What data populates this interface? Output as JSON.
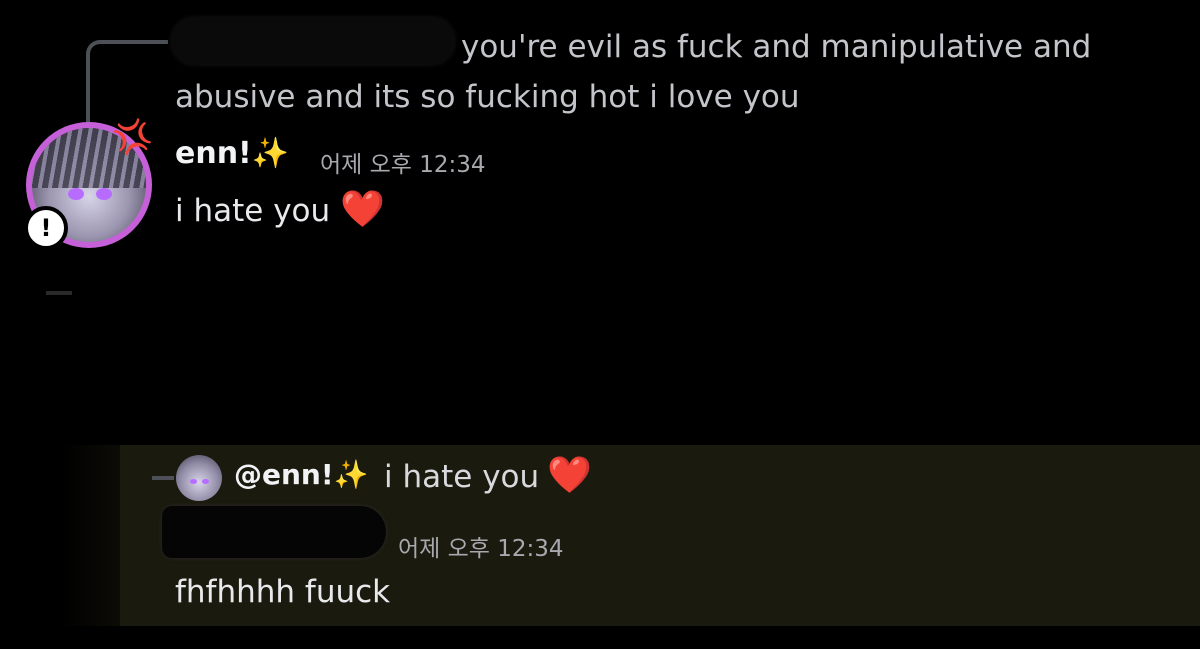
{
  "colors": {
    "background": "#000000",
    "mention_highlight": "#1b1a0e",
    "avatar_ring": "#c560d8",
    "heart": "#e8192e",
    "text_primary": "#f2f3f5",
    "text_muted": "#a7a9ae"
  },
  "messages": [
    {
      "reply_preview_text": "you're evil as fuck and manipulative and abusive and its so fucking hot i love you",
      "author": "enn!",
      "author_emoji": "✨",
      "timestamp": "어제 오후 12:34",
      "content": "i hate you",
      "content_emoji": "❤️"
    },
    {
      "reply_mention": "@enn!",
      "reply_mention_emoji": "✨",
      "reply_preview_text": "i hate you",
      "reply_preview_emoji": "❤️",
      "timestamp": "어제 오후 12:34",
      "content": "fhfhhhh fuuck"
    }
  ],
  "icons": {
    "status": "!",
    "anger": "💢"
  }
}
